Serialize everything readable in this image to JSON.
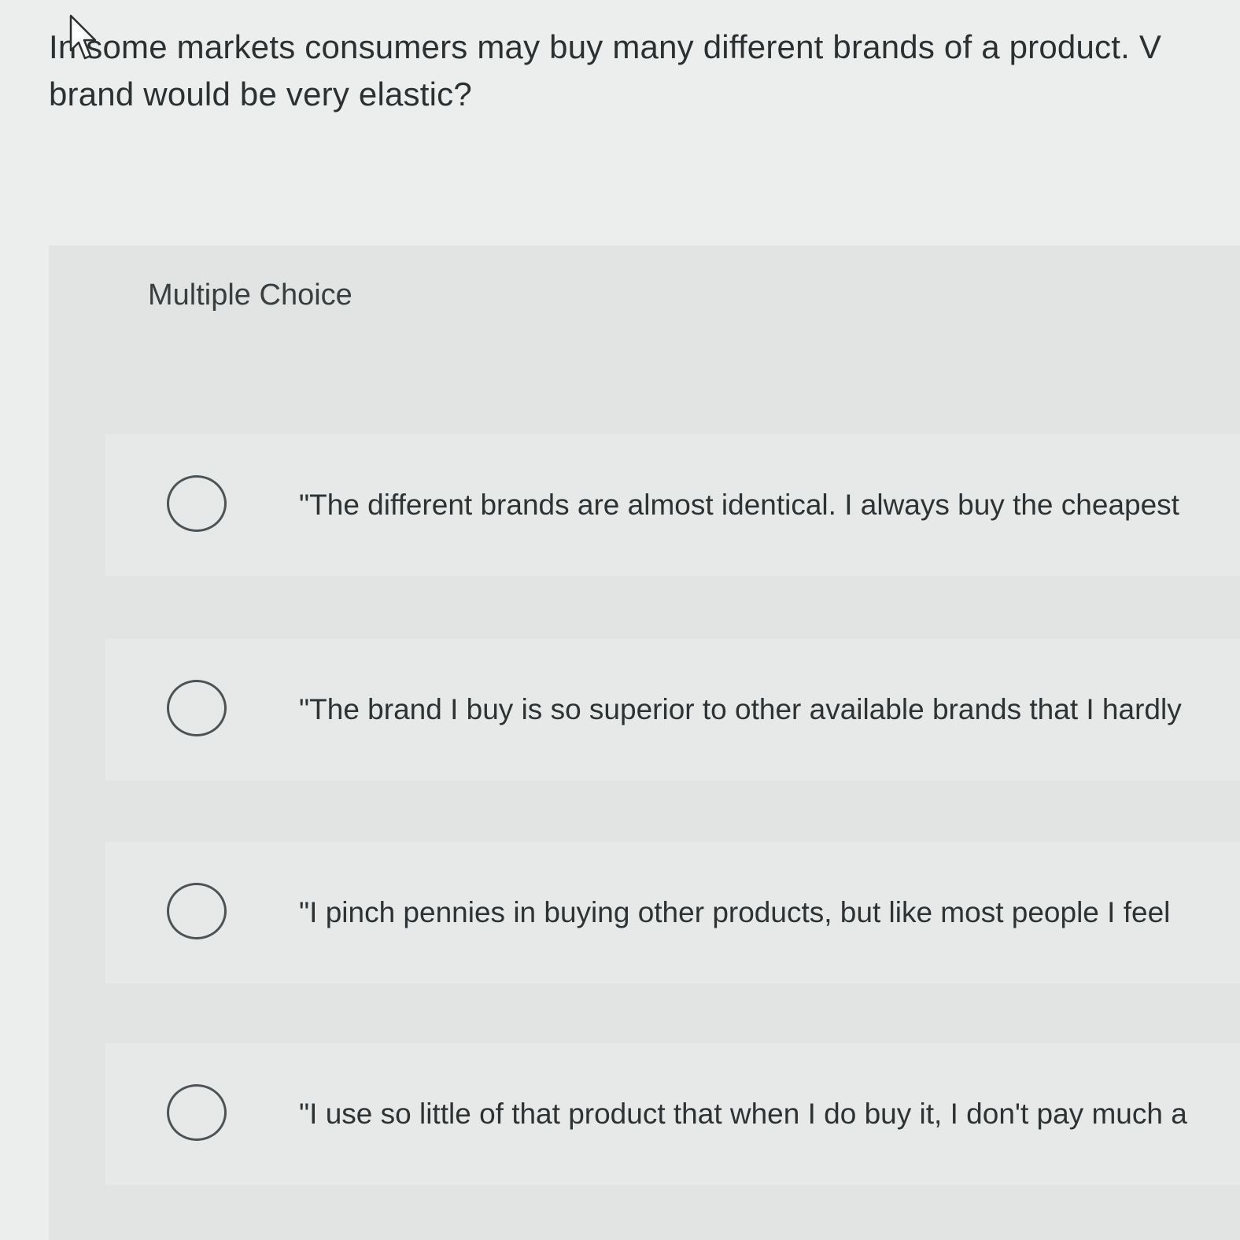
{
  "question": {
    "line1": "In some markets consumers may buy many different brands of a product. V",
    "line2": "brand would be very elastic?"
  },
  "multiple_choice": {
    "heading": "Multiple Choice",
    "options": [
      {
        "label": "\"The different brands are almost identical. I always buy the cheapest"
      },
      {
        "label": "\"The brand I buy is so superior to other available brands that I hardly"
      },
      {
        "label": "\"I pinch pennies in buying other products, but like most people I feel"
      },
      {
        "label": "\"I use so little of that product that when I do buy it, I don't pay much a"
      }
    ]
  },
  "icons": {
    "cursor": "mouse-pointer-icon",
    "radio": "radio-unchecked-icon"
  }
}
